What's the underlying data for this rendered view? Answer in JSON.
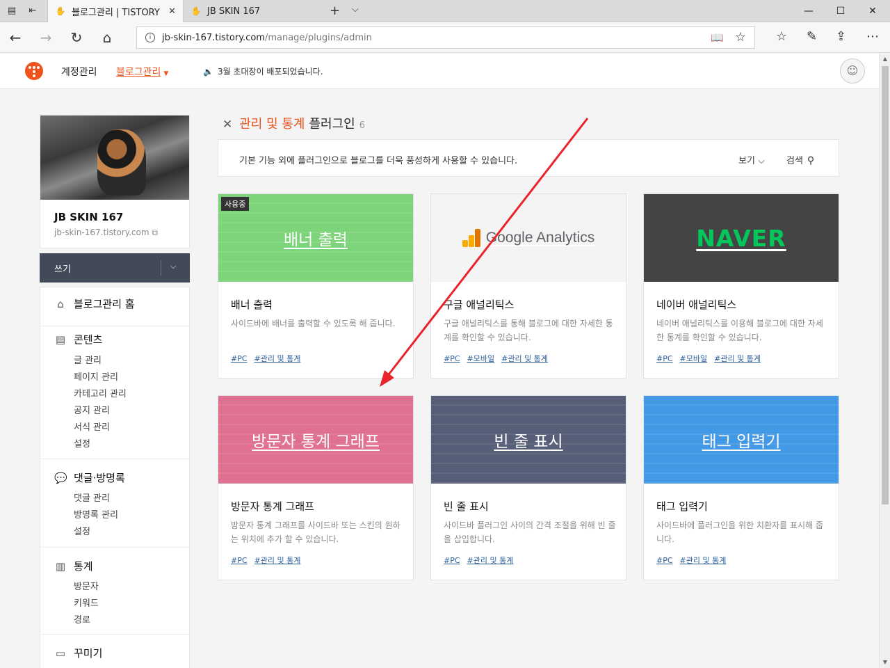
{
  "browser": {
    "tabs": [
      {
        "title": "블로그관리 | TISTORY"
      },
      {
        "title": "JB SKIN 167"
      }
    ],
    "url_host": "jb-skin-167.tistory.com",
    "url_path": "/manage/plugins/admin"
  },
  "header": {
    "account": "계정관리",
    "blog_manage": "블로그관리",
    "notice": "3월 초대장이 배포되었습니다."
  },
  "profile": {
    "name": "JB SKIN 167",
    "url": "jb-skin-167.tistory.com"
  },
  "write_button": "쓰기",
  "menu": {
    "home": "블로그관리 홈",
    "contents": {
      "title": "콘텐츠",
      "items": [
        "글 관리",
        "페이지 관리",
        "카테고리 관리",
        "공지 관리",
        "서식 관리",
        "설정"
      ]
    },
    "comments": {
      "title": "댓글·방명록",
      "items": [
        "댓글 관리",
        "방명록 관리",
        "설정"
      ]
    },
    "stats": {
      "title": "통계",
      "items": [
        "방문자",
        "키워드",
        "경로"
      ]
    },
    "decorate": {
      "title": "꾸미기"
    }
  },
  "page": {
    "category": "관리 및 통계",
    "title": "플러그인",
    "count": "6",
    "description": "기본 기능 외에 플러그인으로 블로그를 더욱 풍성하게 사용할 수 있습니다.",
    "view_label": "보기",
    "search_label": "검색"
  },
  "plugins": [
    {
      "thumb_title": "배너 출력",
      "badge": "사용중",
      "name": "배너 출력",
      "desc": "사이드바에 배너를 출력할 수 있도록 해 줍니다.",
      "tags": [
        "#PC",
        "#관리 및 통계"
      ],
      "color": "#7ed47a"
    },
    {
      "thumb_title": "Google Analytics",
      "name": "구글 애널리틱스",
      "desc": "구글 애널리틱스를 통해 블로그에 대한 자세한 통계를 확인할 수 있습니다.",
      "tags": [
        "#PC",
        "#모바일",
        "#관리 및 통계"
      ],
      "color": "#f4f4f4"
    },
    {
      "thumb_title": "NAVER",
      "name": "네이버 애널리틱스",
      "desc": "네이버 애널리틱스를 이용해 블로그에 대한 자세한 통계를 확인할 수 있습니다.",
      "tags": [
        "#PC",
        "#모바일",
        "#관리 및 통계"
      ],
      "color": "#444444"
    },
    {
      "thumb_title": "방문자 통계 그래프",
      "name": "방문자 통계 그래프",
      "desc": "방문자 통계 그래프를 사이드바 또는 스킨의 원하는 위치에 추가 할 수 있습니다.",
      "tags": [
        "#PC",
        "#관리 및 통계"
      ],
      "color": "#e07090"
    },
    {
      "thumb_title": "빈 줄 표시",
      "name": "빈 줄 표시",
      "desc": "사이드바 플러그인 사이의 간격 조절을 위해 빈 줄을 삽입합니다.",
      "tags": [
        "#PC",
        "#관리 및 통계"
      ],
      "color": "#575e78"
    },
    {
      "thumb_title": "태그 입력기",
      "name": "태그 입력기",
      "desc": "사이드바에 플러그인을 위한 치환자를 표시해 줍니다.",
      "tags": [
        "#PC",
        "#관리 및 통계"
      ],
      "color": "#4499e6"
    }
  ]
}
